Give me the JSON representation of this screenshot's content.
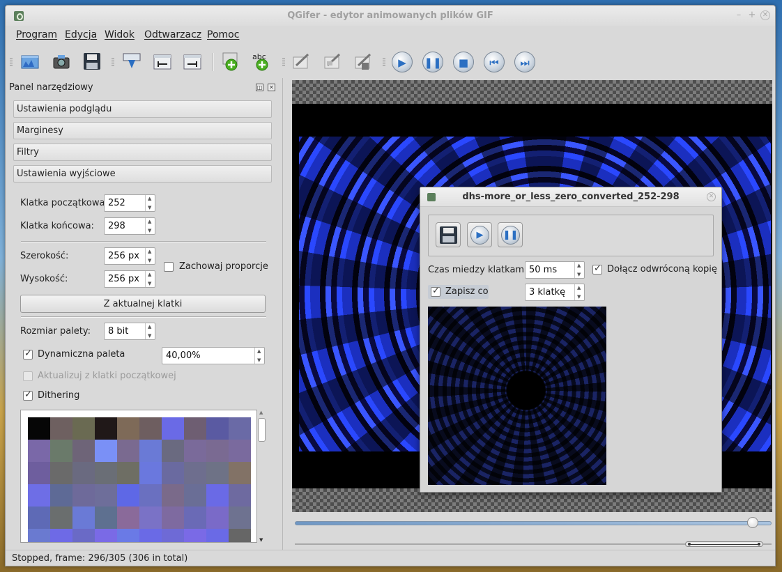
{
  "window": {
    "title": "QGifer - edytor animowanych plików GIF"
  },
  "menu": [
    "Program",
    "Edycja",
    "Widok",
    "Odtwarzacz",
    "Pomoc"
  ],
  "toolbar": {
    "icons": [
      "open-video-icon",
      "open-camera-icon",
      "save-icon",
      "extract-icon",
      "set-start-icon",
      "set-end-icon",
      "add-object-icon",
      "add-text-icon",
      "edit-icon",
      "edit-frame-icon",
      "crop-icon",
      "play-icon",
      "pause-icon",
      "stop-icon",
      "previous-frame-icon",
      "next-frame-icon"
    ],
    "text_icon_label": "abc"
  },
  "panel": {
    "title": "Panel narzędziowy",
    "sections": [
      "Ustawienia podglądu",
      "Marginesy",
      "Filtry",
      "Ustawienia wyjściowe"
    ],
    "start_frame_label": "Klatka początkowa:",
    "start_frame_value": "252",
    "end_frame_label": "Klatka końcowa:",
    "end_frame_value": "298",
    "width_label": "Szerokość:",
    "width_value": "256 px",
    "height_label": "Wysokość:",
    "height_value": "256 px",
    "keep_ratio_label": "Zachowaj proporcje",
    "from_frame_button": "Z aktualnej klatki",
    "palette_size_label": "Rozmiar palety:",
    "palette_size_value": "8 bit",
    "dynamic_palette_label": "Dynamiczna paleta",
    "dynamic_palette_value": "40,00%",
    "update_from_start_label": "Aktualizuj z klatki początkowej",
    "dithering_label": "Dithering",
    "palette_colors": [
      "#060606",
      "#6e6060",
      "#6a6a52",
      "#201818",
      "#7e6a58",
      "#6e5e60",
      "#6a6ae6",
      "#6e5e72",
      "#5a5aa2",
      "#6a6aa6",
      "#7a68a8",
      "#6a7a6a",
      "#6e6478",
      "#7a90f6",
      "#7a6a90",
      "#6a7ad6",
      "#6a6a80",
      "#7a6a9a",
      "#7a6a92",
      "#7a6a9e",
      "#6e5e9e",
      "#6a6a6a",
      "#6a6a80",
      "#6a6e76",
      "#6e6e64",
      "#6a78de",
      "#6a6aa0",
      "#6e6e8e",
      "#6e7286",
      "#827266",
      "#6e6ee6",
      "#5e6a96",
      "#6e6a9a",
      "#6e6e9a",
      "#5e68e6",
      "#6a70c0",
      "#7a6a8a",
      "#6a6e96",
      "#6a6ae6",
      "#6e6aa0",
      "#5e6ab6",
      "#6a6e6e",
      "#6a7ad6",
      "#5e7090",
      "#8a6a9a",
      "#7a72c6",
      "#7e6aa0",
      "#6a6ab6",
      "#7a6ac8",
      "#6e7290",
      "#6a7ad0",
      "#6e6ae6",
      "#6a6ac6",
      "#7a6ae6",
      "#6a7ae6",
      "#6a6ae6",
      "#6e6ad6",
      "#7a6ae6",
      "#6a6ae6",
      "#666666"
    ]
  },
  "status": {
    "text": "Stopped, frame: 296/305 (306 in total)"
  },
  "playback": {
    "position_fraction": 0.96
  },
  "dialog": {
    "title": "dhs-more_or_less_zero_converted_252-298",
    "delay_label": "Czas miedzy klatkami:",
    "delay_value": "50 ms",
    "reverse_copy_label": "Dołącz odwróconą kopię",
    "save_every_label": "Zapisz co",
    "save_every_value": "3 klatkę"
  }
}
